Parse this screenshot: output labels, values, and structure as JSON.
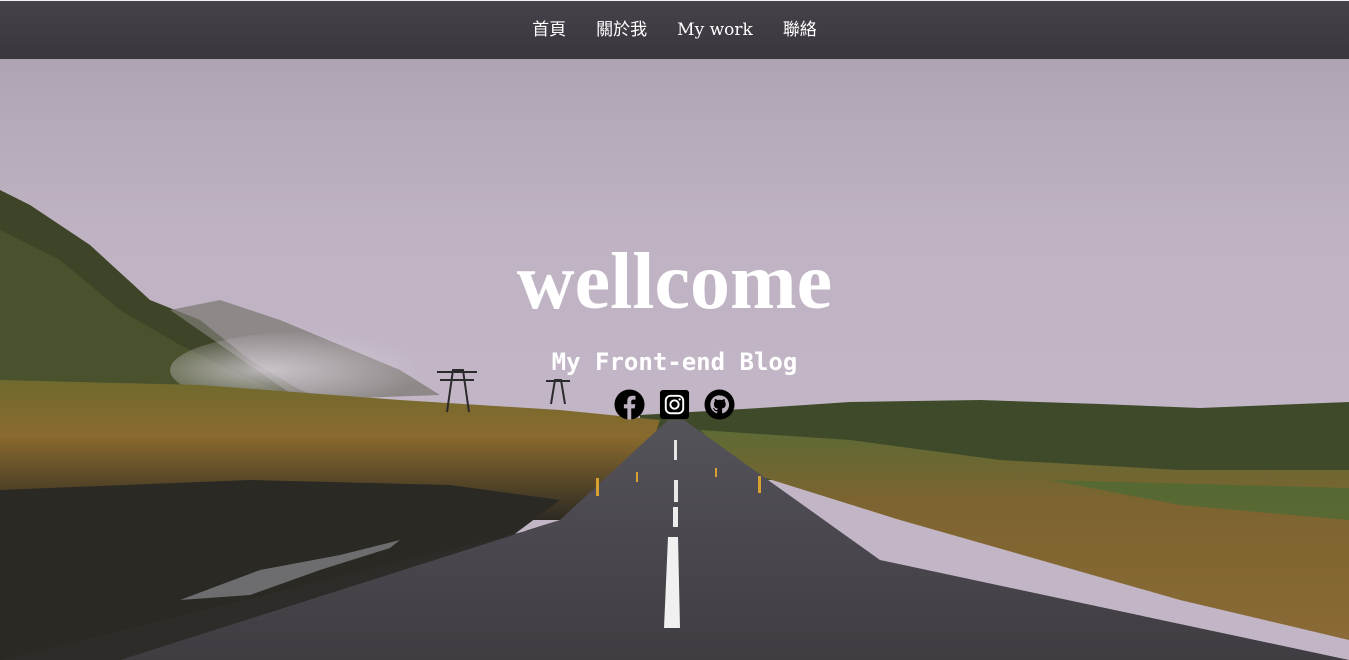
{
  "nav": {
    "items": [
      {
        "label": "首頁"
      },
      {
        "label": "關於我"
      },
      {
        "label": "My work"
      },
      {
        "label": "聯絡"
      }
    ]
  },
  "hero": {
    "title": "wellcome",
    "subtitle": "My Front-end Blog",
    "background": "landscape-road-photo"
  },
  "social": {
    "icons": [
      "facebook-icon",
      "instagram-icon",
      "github-icon"
    ]
  },
  "colors": {
    "nav_bg": "#403c43",
    "text": "#ffffff"
  }
}
